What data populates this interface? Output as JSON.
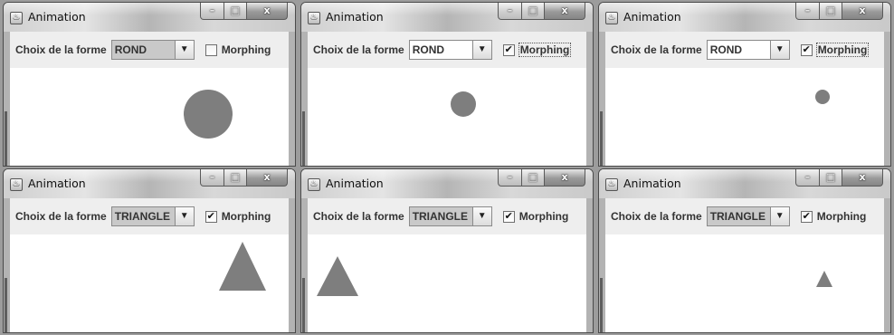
{
  "windows": [
    {
      "title": "Animation",
      "shape_label": "Choix de la forme",
      "shape_value": "ROND",
      "morphing_label": "Morphing",
      "morphing_checked": false,
      "checkbox_mark": ""
    },
    {
      "title": "Animation",
      "shape_label": "Choix de la forme",
      "shape_value": "ROND",
      "morphing_label": "Morphing",
      "morphing_checked": true,
      "checkbox_mark": "✔"
    },
    {
      "title": "Animation",
      "shape_label": "Choix de la forme",
      "shape_value": "ROND",
      "morphing_label": "Morphing",
      "morphing_checked": true,
      "checkbox_mark": "✔"
    },
    {
      "title": "Animation",
      "shape_label": "Choix de la forme",
      "shape_value": "TRIANGLE",
      "morphing_label": "Morphing",
      "morphing_checked": true,
      "checkbox_mark": "✔"
    },
    {
      "title": "Animation",
      "shape_label": "Choix de la forme",
      "shape_value": "TRIANGLE",
      "morphing_label": "Morphing",
      "morphing_checked": true,
      "checkbox_mark": "✔"
    },
    {
      "title": "Animation",
      "shape_label": "Choix de la forme",
      "shape_value": "TRIANGLE",
      "morphing_label": "Morphing",
      "morphing_checked": true,
      "checkbox_mark": "✔"
    }
  ],
  "window_controls": {
    "minimize": "–",
    "maximize": "□",
    "close": "x"
  },
  "combo_arrow": "▼",
  "app_icon": "♨",
  "colors": {
    "shape": "#7e7e7e",
    "toolbar": "#eeeeee",
    "canvas": "#ffffff"
  }
}
